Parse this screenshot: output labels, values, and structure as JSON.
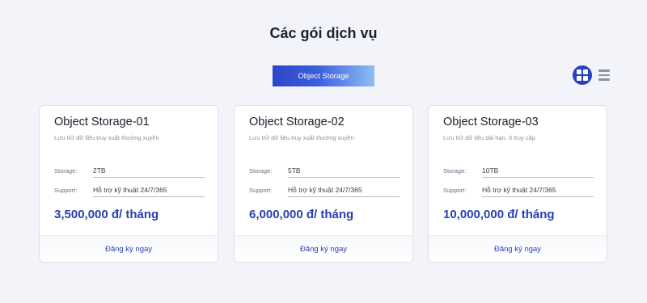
{
  "page": {
    "title": "Các gói dịch vụ"
  },
  "tabs": [
    {
      "label": "Object Storage",
      "active": true
    }
  ],
  "view_toggle": {
    "options": [
      "grid-view-icon",
      "list-view-icon"
    ],
    "active": "grid",
    "active_color": "#2740c6"
  },
  "plans": [
    {
      "name": "Object Storage-01",
      "description": "Lưu trữ dữ liệu truy xuất thường xuyên",
      "storage_label": "Storage:",
      "storage_value": "2TB",
      "support_label": "Support:",
      "support_value": "Hỗ trợ kỹ thuật 24/7/365",
      "price": "3,500,000 đ/ tháng",
      "cta": "Đăng ký ngay"
    },
    {
      "name": "Object Storage-02",
      "description": "Lưu trữ dữ liệu truy xuất thường xuyên",
      "storage_label": "Storage:",
      "storage_value": "5TB",
      "support_label": "Support:",
      "support_value": "Hỗ trợ kỹ thuật 24/7/365",
      "price": "6,000,000 đ/ tháng",
      "cta": "Đăng ký ngay"
    },
    {
      "name": "Object Storage-03",
      "description": "Lưu trữ dữ liệu dài hạn, ít truy cập",
      "storage_label": "Storage:",
      "storage_value": "10TB",
      "support_label": "Support:",
      "support_value": "Hỗ trợ kỹ thuật 24/7/365",
      "price": "10,000,000 đ/ tháng",
      "cta": "Đăng ký ngay"
    }
  ],
  "colors": {
    "accent": "#2a3fb3",
    "background": "#f3f4f9"
  }
}
